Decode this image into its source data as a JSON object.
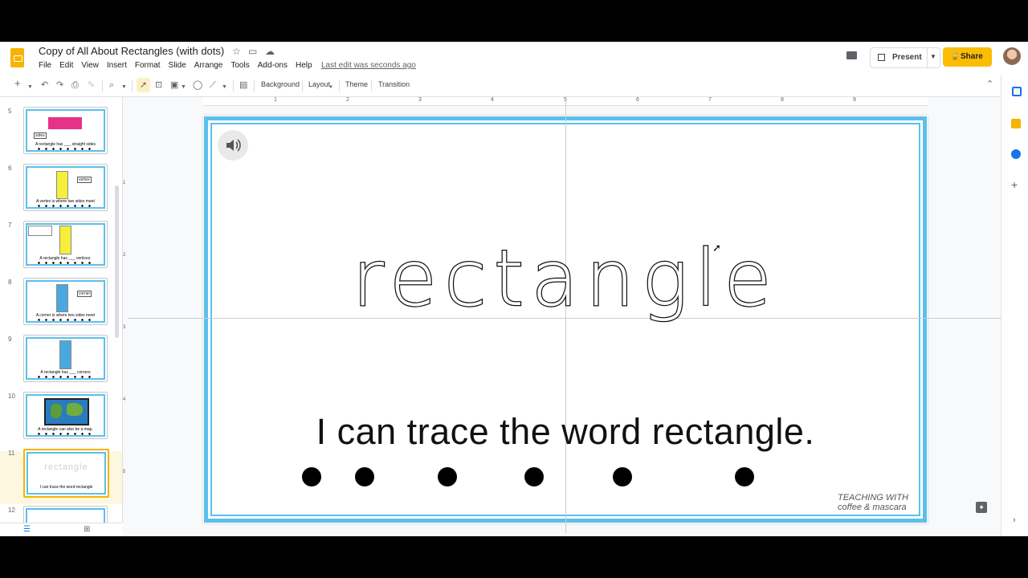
{
  "header": {
    "title": "Copy of All About Rectangles (with dots)",
    "menus": [
      "File",
      "Edit",
      "View",
      "Insert",
      "Format",
      "Slide",
      "Arrange",
      "Tools",
      "Add-ons",
      "Help"
    ],
    "last_edit": "Last edit was seconds ago",
    "present_label": "Present",
    "share_label": "Share"
  },
  "toolbar": {
    "background_label": "Background",
    "layout_label": "Layout",
    "theme_label": "Theme",
    "transition_label": "Transition"
  },
  "filmstrip": {
    "slides": [
      {
        "num": "5",
        "caption": "A rectangle has ___ straight sides"
      },
      {
        "num": "6",
        "caption": "A vertex is where two sides meet"
      },
      {
        "num": "7",
        "caption": "A rectangle has ___ vertices."
      },
      {
        "num": "8",
        "caption": "A corner is where two sides meet"
      },
      {
        "num": "9",
        "caption": "A rectangle has ___ corners"
      },
      {
        "num": "10",
        "caption": "A rectangle can also be a map."
      },
      {
        "num": "11",
        "caption": "I can trace the word rectangle",
        "thumb_word": "rectangle"
      },
      {
        "num": "12",
        "caption": ""
      }
    ],
    "thumb_labels": {
      "sides": "sides",
      "vertex": "vertex",
      "corner": "corner"
    }
  },
  "ruler": {
    "h": [
      "1",
      "2",
      "3",
      "4",
      "5",
      "6",
      "7",
      "8",
      "9"
    ],
    "v": [
      "1",
      "2",
      "3",
      "4",
      "5"
    ]
  },
  "slide": {
    "traced_word": "rectangle",
    "caption": "I can trace the word rectangle.",
    "brand": "TEACHING WITH coffee & mascara",
    "dot_count": 6
  },
  "colors": {
    "accent": "#f4b400",
    "share": "#fbbc04",
    "frame": "#5bc0eb",
    "thumb1": "#e6338a",
    "thumb2": "#f5ee3a",
    "thumb3": "#4aa8e0"
  }
}
